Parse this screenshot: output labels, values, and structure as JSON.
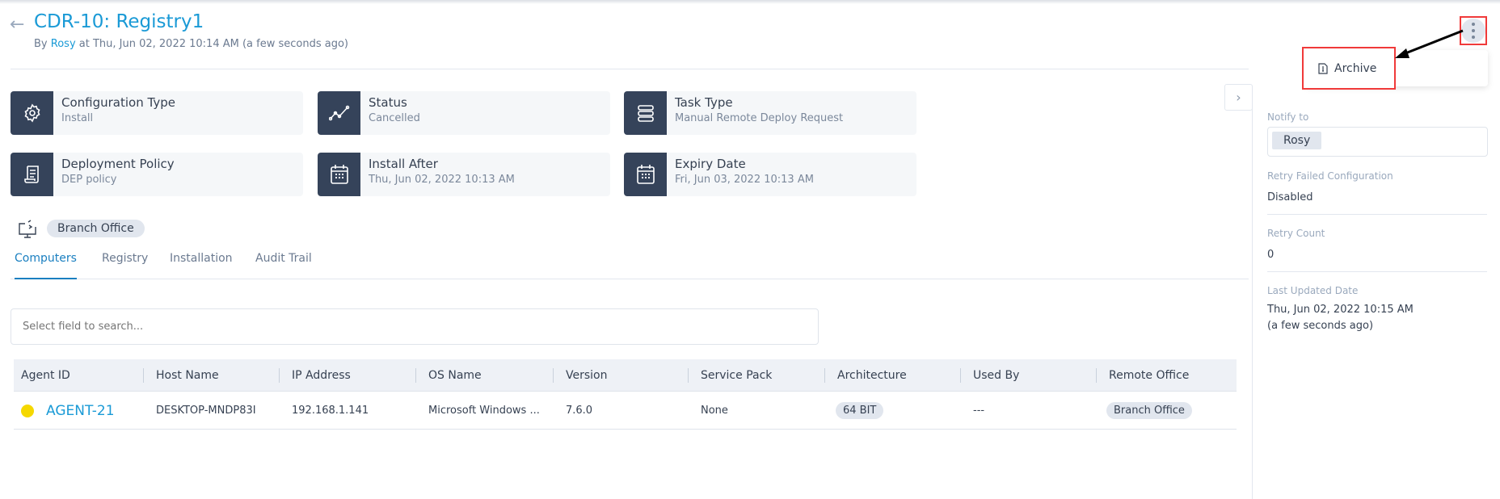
{
  "header": {
    "title": "CDR-10: Registry1",
    "by": "By",
    "user": "Rosy",
    "at": "at Thu, Jun 02, 2022 10:14 AM",
    "relative": "(a few seconds ago)"
  },
  "cards": [
    {
      "title": "Configuration Type",
      "value": "Install",
      "icon": "gear-icon"
    },
    {
      "title": "Status",
      "value": "Cancelled",
      "icon": "trend-icon"
    },
    {
      "title": "Task Type",
      "value": "Manual Remote Deploy Request",
      "icon": "task-icon"
    },
    {
      "title": "Deployment Policy",
      "value": "DEP policy",
      "icon": "scroll-icon"
    },
    {
      "title": "Install After",
      "value": "Thu, Jun 02, 2022 10:13 AM",
      "icon": "calendar-icon"
    },
    {
      "title": "Expiry Date",
      "value": "Fri, Jun 03, 2022 10:13 AM",
      "icon": "calendar-icon"
    }
  ],
  "scope": {
    "chip": "Branch Office"
  },
  "tabs": [
    "Computers",
    "Registry",
    "Installation",
    "Audit Trail"
  ],
  "search": {
    "placeholder": "Select field to search..."
  },
  "table": {
    "headers": [
      "Agent ID",
      "Host Name",
      "IP Address",
      "OS Name",
      "Version",
      "Service Pack",
      "Architecture",
      "Used By",
      "Remote Office"
    ],
    "rows": [
      {
        "agent": "AGENT-21",
        "status_color": "#f5d800",
        "host": "DESKTOP-MNDP83I",
        "ip": "192.168.1.141",
        "os": "Microsoft Windows ...",
        "version": "7.6.0",
        "sp": "None",
        "arch": "64 BIT",
        "used_by": "---",
        "office": "Branch Office"
      }
    ]
  },
  "sidebar": {
    "notify_label": "Notify to",
    "notify_value": "Rosy",
    "retry_failed_label": "Retry Failed Configuration",
    "retry_failed_value": "Disabled",
    "retry_count_label": "Retry Count",
    "retry_count_value": "0",
    "last_updated_label": "Last Updated Date",
    "last_updated_value": "Thu, Jun 02, 2022 10:15 AM",
    "last_updated_relative": "(a few seconds ago)"
  },
  "menu": {
    "archive": "Archive"
  },
  "colors": {
    "accent": "#1a9ad6",
    "icon_bg": "#35435a",
    "highlight": "#f03a3a"
  }
}
